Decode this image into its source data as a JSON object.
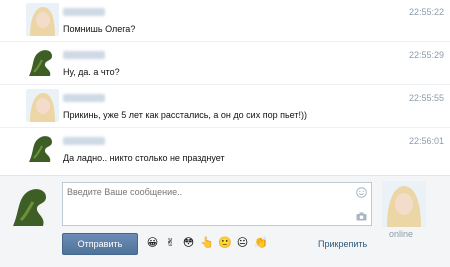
{
  "messages": [
    {
      "sender": "female",
      "text": "Помнишь Олега?",
      "time": "22:55:22"
    },
    {
      "sender": "dino",
      "text": "Ну, да. а что?",
      "time": "22:55:29"
    },
    {
      "sender": "female",
      "text": "Прикинь, уже 5 лет как расстались, а он до сих пор пьет!))",
      "time": "22:55:55"
    },
    {
      "sender": "dino",
      "text": "Да ладно.. никто столько не празднует",
      "time": "22:56:01"
    }
  ],
  "compose": {
    "placeholder": "Введите Ваше сообщение..",
    "send_label": "Отправить",
    "attach_label": "Прикрепить",
    "peer_status": "online"
  },
  "emojis": [
    "😀",
    "✌",
    "😳",
    "👆",
    "🙂",
    "😐",
    "👏"
  ],
  "colors": {
    "accent": "#507399",
    "link": "#2b587a",
    "time": "#8c9cab"
  }
}
